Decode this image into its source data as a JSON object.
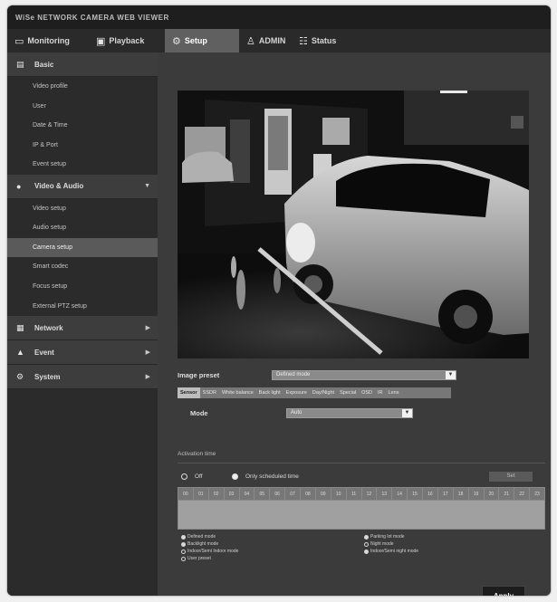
{
  "window": {
    "title": "WiSe NETWORK CAMERA WEB VIEWER"
  },
  "topnav": {
    "monitoring": "Monitoring",
    "playback": "Playback",
    "setup": "Setup",
    "admin": "ADMIN",
    "status": "Status"
  },
  "sidebar": {
    "basic": {
      "label": "Basic",
      "items": [
        "Video profile",
        "User",
        "Date & Time",
        "IP & Port",
        "Event setup"
      ]
    },
    "video_audio": {
      "label": "Video & Audio",
      "items": [
        "Video setup",
        "Audio setup",
        "Camera setup",
        "Smart codec",
        "Focus setup",
        "External PTZ setup"
      ],
      "active_item": "Camera setup"
    },
    "network": {
      "label": "Network"
    },
    "event": {
      "label": "Event"
    },
    "system": {
      "label": "System"
    }
  },
  "main": {
    "image_preset_label": "Image preset",
    "image_preset_value": "Defined mode",
    "tabs": [
      "Sensor",
      "SSDR",
      "White balance",
      "Back light",
      "Exposure",
      "Day/Night",
      "Special",
      "OSD",
      "IR",
      "Lens"
    ],
    "active_tab": "Sensor",
    "mode_label": "Mode",
    "mode_value": "Auto",
    "schedule_title": "Activation time",
    "radio_off": "Off",
    "radio_scheduled": "Only scheduled time",
    "radio_selected": "scheduled",
    "set_button": "Set",
    "hours": [
      "00",
      "01",
      "02",
      "03",
      "04",
      "05",
      "06",
      "07",
      "08",
      "09",
      "10",
      "11",
      "12",
      "13",
      "14",
      "15",
      "16",
      "17",
      "18",
      "19",
      "20",
      "21",
      "22",
      "23"
    ],
    "legend": {
      "col1": [
        "Defined mode",
        "Backlight mode",
        "Indoor/Semi Indoor mode",
        "User preset"
      ],
      "col2": [
        "Parking lot mode",
        "Night mode",
        "Indoor/Semi night mode"
      ]
    },
    "apply_button": "Apply"
  },
  "colors": {
    "frame_bg": "#3a3a3a",
    "sidebar_bg": "#2b2b2b",
    "active_tab_bg": "#606060"
  },
  "icons": {
    "monitoring": "monitor-icon",
    "playback": "film-icon",
    "setup": "gear-icon",
    "admin": "user-icon",
    "status": "status-icon",
    "basic": "basic-icon",
    "video_audio": "camera-icon",
    "network": "network-icon",
    "event": "event-icon",
    "system": "system-icon"
  }
}
